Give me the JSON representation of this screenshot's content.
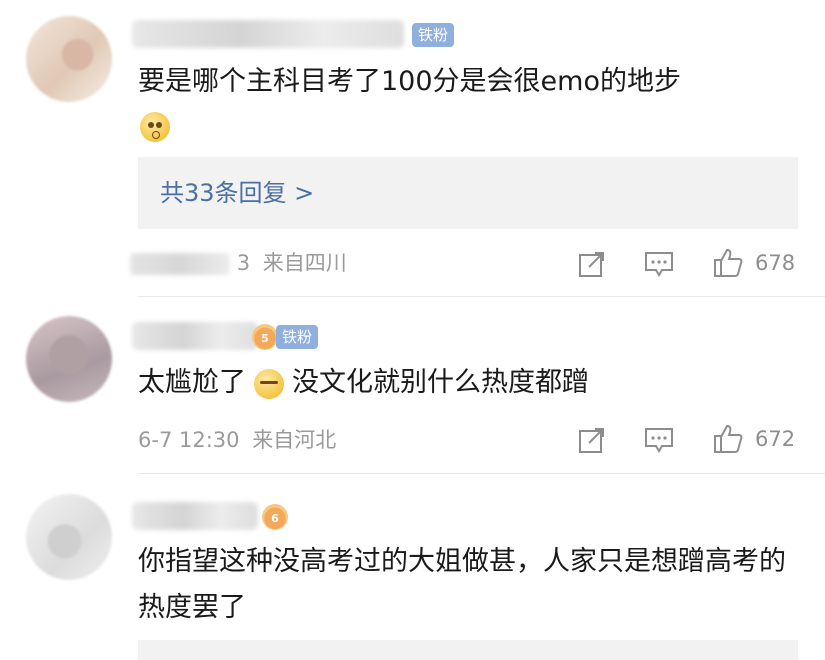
{
  "comments": [
    {
      "username": "",
      "badge": "铁粉",
      "text": "要是哪个主科目考了100分是会很emo的地步",
      "emoji": "cold-sweat-face",
      "reply_link": "共33条回复 >",
      "meta": {
        "time": "3",
        "location": "来自四川"
      },
      "likes": "678"
    },
    {
      "username": "",
      "badge": "铁粉",
      "badge_level": "5",
      "text_before": "太尴尬了",
      "emoji": "zipped-face",
      "text_after": "没文化就别什么热度都蹭",
      "meta": {
        "time": "6-7 12:30",
        "location": "来自河北"
      },
      "likes": "672"
    },
    {
      "username": "",
      "badge_level": "6",
      "text": "你指望这种没高考过的大姐做甚，人家只是想蹭高考的热度罢了"
    }
  ],
  "icons": {
    "share": "share-icon",
    "comment": "comment-icon",
    "like": "thumbs-up-icon"
  },
  "colors": {
    "badge": "#8fb0df",
    "link": "#4a6fa5",
    "meta": "#9a9a9a"
  }
}
